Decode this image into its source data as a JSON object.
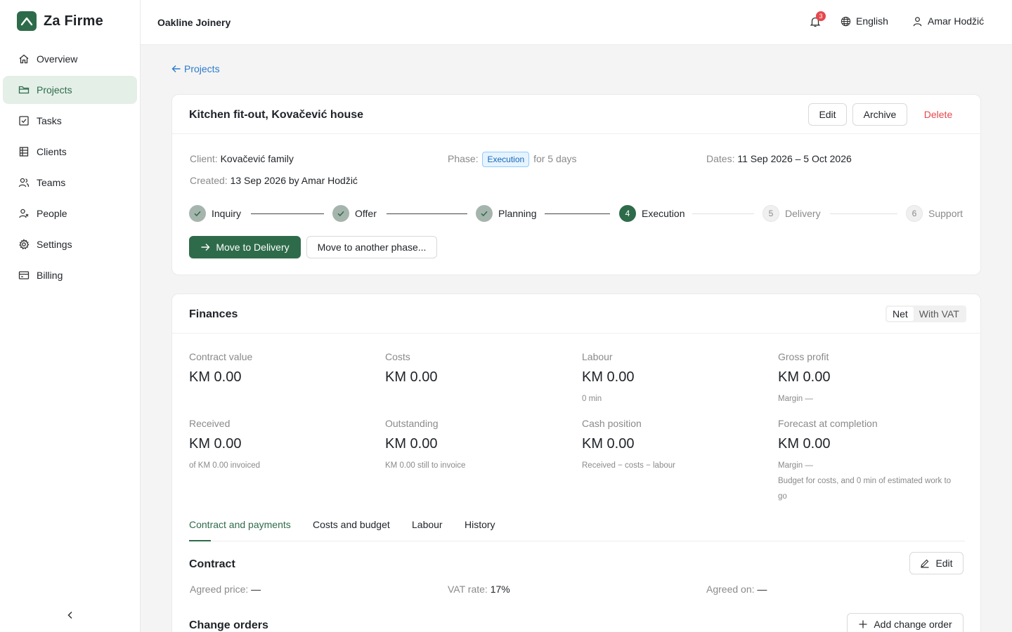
{
  "brand": {
    "name": "Za Firme",
    "accent": "#2e6b4a"
  },
  "sidebar": {
    "items": [
      {
        "label": "Overview",
        "icon": "home-icon"
      },
      {
        "label": "Projects",
        "icon": "folder-icon",
        "active": true
      },
      {
        "label": "Tasks",
        "icon": "checkbox-icon"
      },
      {
        "label": "Clients",
        "icon": "building-icon"
      },
      {
        "label": "Teams",
        "icon": "team-icon"
      },
      {
        "label": "People",
        "icon": "people-icon"
      },
      {
        "label": "Settings",
        "icon": "gear-icon"
      },
      {
        "label": "Billing",
        "icon": "card-icon"
      }
    ]
  },
  "topbar": {
    "org": "Oakline Joinery",
    "notifications": "3",
    "language": "English",
    "user": "Amar Hodžić"
  },
  "back": {
    "label": "Projects"
  },
  "project": {
    "title": "Kitchen fit-out, Kovačević house",
    "actions": {
      "edit": "Edit",
      "archive": "Archive",
      "delete": "Delete"
    },
    "client_label": "Client:",
    "client": "Kovačević family",
    "phase_label": "Phase:",
    "phase": "Execution",
    "phase_duration": "for 5 days",
    "dates_label": "Dates:",
    "dates": "11 Sep 2026 – 5 Oct 2026",
    "created_label": "Created:",
    "created": "13 Sep 2026 by Amar Hodžić",
    "steps": [
      {
        "label": "Inquiry",
        "state": "done"
      },
      {
        "label": "Offer",
        "state": "done"
      },
      {
        "label": "Planning",
        "state": "done"
      },
      {
        "label": "Execution",
        "state": "current",
        "number": "4"
      },
      {
        "label": "Delivery",
        "state": "todo",
        "number": "5"
      },
      {
        "label": "Support",
        "state": "todo",
        "number": "6"
      }
    ],
    "move_primary": "Move to Delivery",
    "move_other": "Move to another phase..."
  },
  "finances": {
    "title": "Finances",
    "toggle": {
      "net": "Net",
      "vat": "With VAT"
    },
    "stats": [
      {
        "label": "Contract value",
        "value": "KM 0.00",
        "sub": ""
      },
      {
        "label": "Costs",
        "value": "KM 0.00",
        "sub": ""
      },
      {
        "label": "Labour",
        "value": "KM 0.00",
        "sub": "0 min"
      },
      {
        "label": "Gross profit",
        "value": "KM 0.00",
        "sub": "Margin —"
      },
      {
        "label": "Received",
        "value": "KM 0.00",
        "sub": "of KM 0.00 invoiced"
      },
      {
        "label": "Outstanding",
        "value": "KM 0.00",
        "sub": "KM 0.00 still to invoice"
      },
      {
        "label": "Cash position",
        "value": "KM 0.00",
        "sub": "Received − costs − labour"
      },
      {
        "label": "Forecast at completion",
        "value": "KM 0.00",
        "sub": "Margin —",
        "sub2": "Budget for costs, and 0 min of estimated work to go"
      }
    ],
    "tabs": [
      "Contract and payments",
      "Costs and budget",
      "Labour",
      "History"
    ],
    "contract": {
      "title": "Contract",
      "edit": "Edit",
      "agreed_price_label": "Agreed price:",
      "agreed_price": "—",
      "vat_rate_label": "VAT rate:",
      "vat_rate": "17%",
      "agreed_on_label": "Agreed on:",
      "agreed_on": "—"
    },
    "change_orders": {
      "title": "Change orders",
      "add": "Add change order"
    }
  }
}
